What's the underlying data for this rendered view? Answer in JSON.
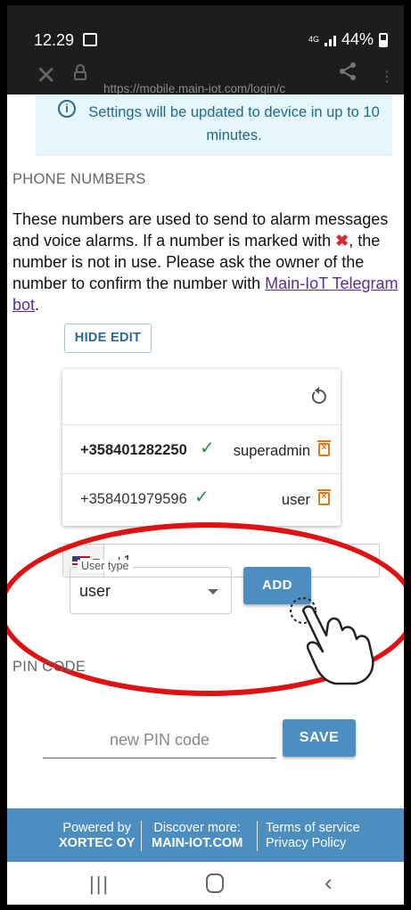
{
  "statusbar": {
    "time": "12.29",
    "network": "4G",
    "battery": "44%"
  },
  "browser": {
    "url": "https://mobile.main-iot.com/login/c"
  },
  "info": {
    "text": "Settings will be updated to device in up to 10 minutes."
  },
  "phone_section": {
    "title": "PHONE NUMBERS",
    "description_before": "These numbers are used to send to alarm messages and voice alarms. If a number is marked with ",
    "description_after": ", the number is not in use. Please ask the owner of the number to confirm the number with ",
    "link_text": "Main-IoT Telegram bot",
    "description_end": ".",
    "hide_edit_label": "HIDE EDIT",
    "numbers": [
      {
        "number": "+358401282250",
        "role": "superadmin"
      },
      {
        "number": "+358401979596",
        "role": "user"
      }
    ],
    "new_number_value": "+1",
    "user_type_label": "User type",
    "user_type_value": "user",
    "add_label": "ADD"
  },
  "pin_section": {
    "title": "PIN CODE",
    "placeholder": "new PIN code",
    "save_label": "SAVE"
  },
  "footer": {
    "powered_by": "Powered by",
    "company": "XORTEC OY",
    "discover": "Discover more:",
    "site": "MAIN-IOT.COM",
    "terms": "Terms of service",
    "privacy": "Privacy Policy"
  },
  "colors": {
    "accent": "#4d8ec0",
    "annotation": "#e01111",
    "check": "#2e8b3e",
    "trash": "#e0761a"
  }
}
